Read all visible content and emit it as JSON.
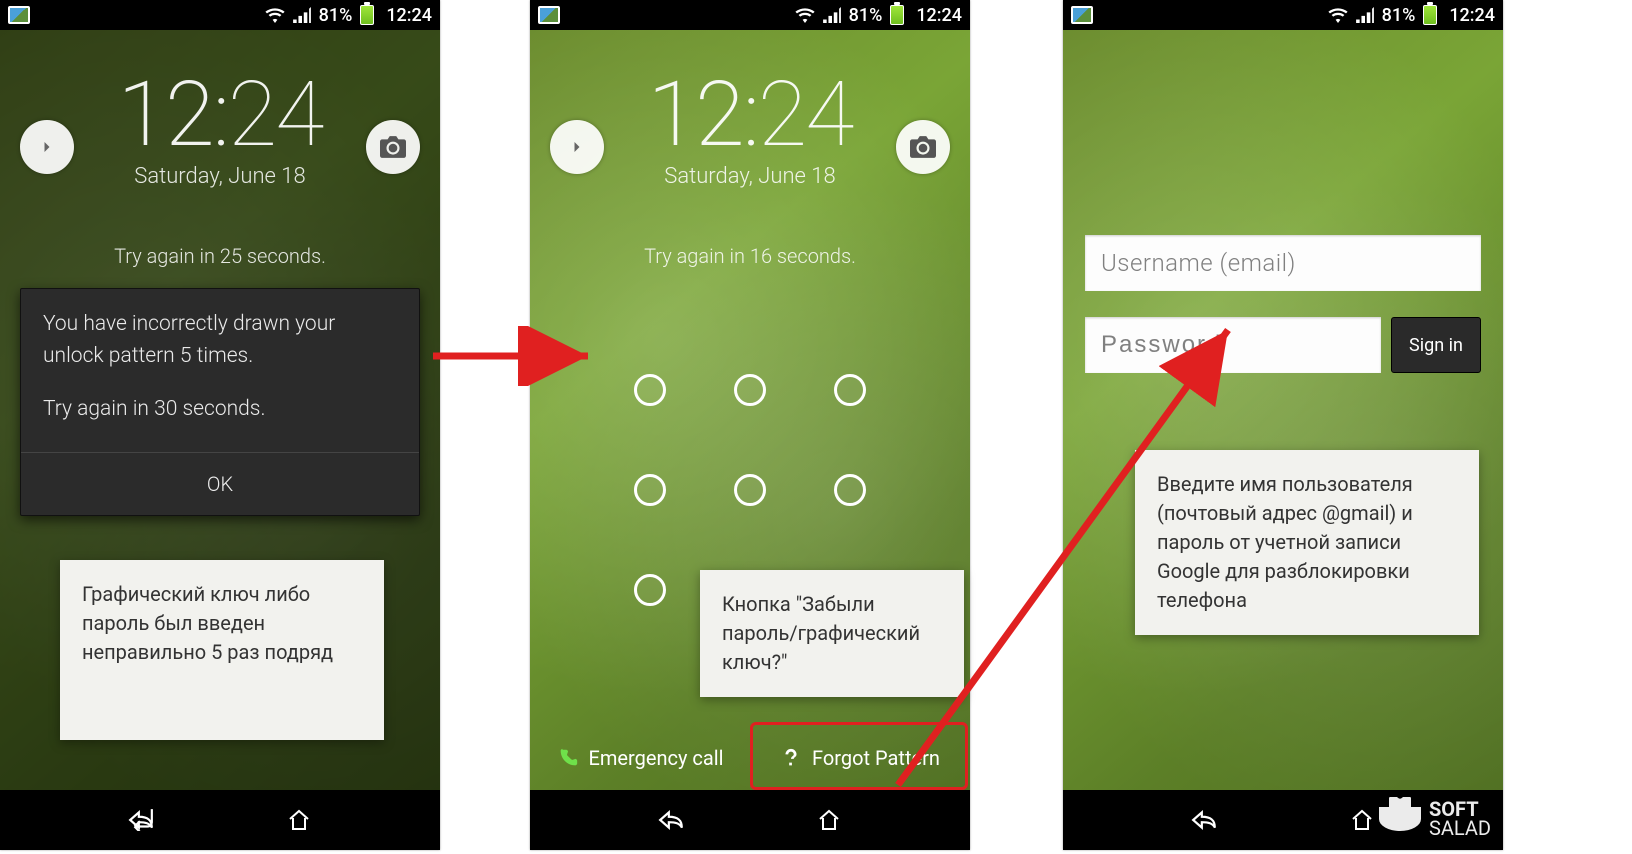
{
  "status": {
    "battery_pct": "81%",
    "time": "12:24"
  },
  "clock": {
    "hour": "12",
    "colon": ":",
    "minute": "24",
    "date": "Saturday, June 18"
  },
  "screen1": {
    "countdown": "Try again in 25 seconds.",
    "dialog_line1": "You have incorrectly drawn your unlock pattern 5 times.",
    "dialog_line2": "Try again in 30 seconds.",
    "dialog_ok": "OK",
    "note": "Графический ключ либо пароль был введен неправильно 5 раз подряд"
  },
  "screen2": {
    "countdown": "Try again in 16 seconds.",
    "emergency": "Emergency call",
    "forgot": "Forgot Pattern",
    "note": "Кнопка \"Забыли пароль/графический ключ?\""
  },
  "screen3": {
    "username_ph": "Username (email)",
    "password_ph": "Password",
    "signin": "Sign in",
    "note": "Введите имя пользователя (почтовый адрес @gmail) и пароль от учетной записи Google для разблокировки телефона"
  },
  "logo": {
    "top": "SOFT",
    "bottom": "SALAD"
  }
}
